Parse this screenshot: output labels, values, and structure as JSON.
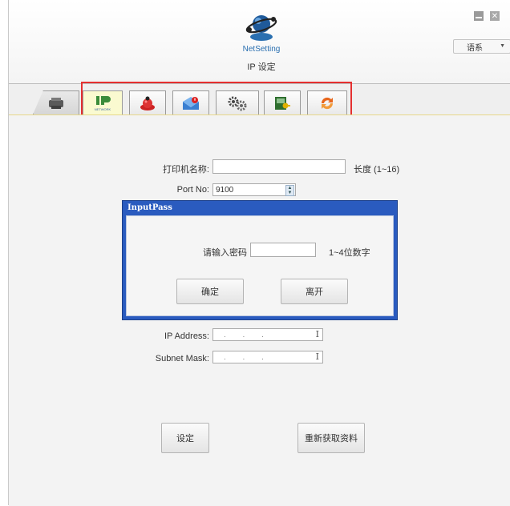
{
  "app": {
    "logo_text": "NetSetting",
    "page_title": "IP 设定"
  },
  "language": {
    "selected": "语系"
  },
  "tabs": [
    {
      "icon": "printer-icon"
    },
    {
      "icon": "ip-network-icon",
      "label": "NETWORK",
      "active": true
    },
    {
      "icon": "alert-bell-icon"
    },
    {
      "icon": "mail-warning-icon"
    },
    {
      "icon": "settings-gears-icon"
    },
    {
      "icon": "key-card-icon"
    },
    {
      "icon": "refresh-arrows-icon"
    }
  ],
  "form": {
    "printer_name_label": "打印机名称:",
    "printer_name_value": "",
    "printer_name_hint": "长度 (1~16)",
    "port_label": "Port No:",
    "port_value": "9100",
    "ip_label": "IP Address:",
    "subnet_label": "Subnet Mask:",
    "ip_placeholder": ". . .",
    "set_button": "设定",
    "refresh_button": "重新获取资料"
  },
  "dialog": {
    "title": "InputPass",
    "password_label": "请输入密码",
    "password_value": "",
    "password_hint": "1~4位数字",
    "ok_button": "确定",
    "leave_button": "离开"
  },
  "colors": {
    "dialog_titlebar": "#2a5bbf",
    "highlight_border": "#e53030",
    "tab_active": "#fafad0"
  }
}
